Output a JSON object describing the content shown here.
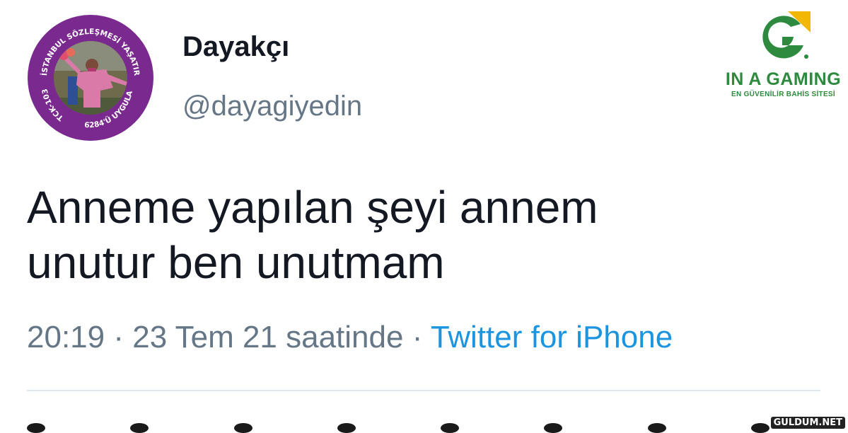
{
  "tweet": {
    "avatar": {
      "ring_text_top": "İSTANBUL SÖZLEŞMESİ YAŞATIR",
      "ring_text_left": "TCK-103",
      "ring_text_bottom": "6284'Ü UYGULA",
      "ring_color": "#7a2a8f"
    },
    "display_name": "Dayakçı",
    "handle": "@dayagiyedin",
    "text_line_1": "Anneme yapılan şeyi annem",
    "text_line_2": "unutur ben unutmam",
    "time": "20:19",
    "separator_1": "·",
    "date": "23 Tem 21 saatinde",
    "separator_2": "·",
    "source": "Twitter for iPhone"
  },
  "brand": {
    "name": "IN A GAMING",
    "tagline": "EN GÜVENİLİR BAHİS SİTESİ",
    "icon": "g-logo-icon",
    "colors": {
      "green": "#2d8a3e",
      "yellow": "#f2b705"
    }
  },
  "watermark": {
    "text": "GULDUM.NET"
  },
  "colors": {
    "text": "#141823",
    "secondary": "#657786",
    "link": "#1b95e0",
    "divider": "#e1e8ed"
  }
}
